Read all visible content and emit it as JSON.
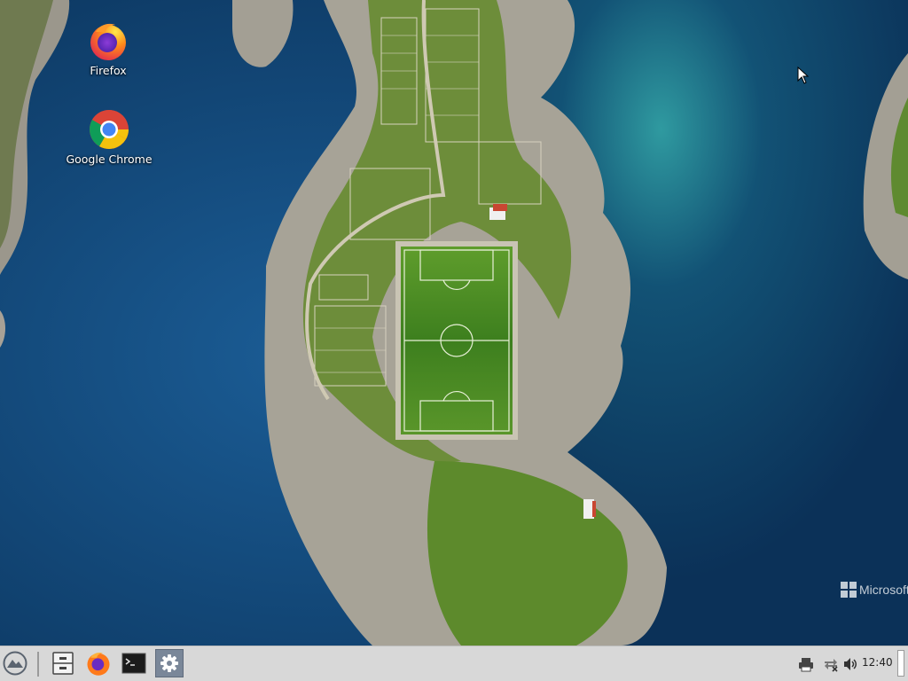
{
  "desktop": {
    "icons": [
      {
        "name": "firefox",
        "label": "Firefox"
      },
      {
        "name": "chrome",
        "label": "Google Chrome"
      }
    ],
    "watermark": "Microsoft"
  },
  "taskbar": {
    "start_icon": "zorin-logo-icon",
    "launchers": [
      {
        "name": "files",
        "icon": "file-cabinet-icon"
      },
      {
        "name": "firefox",
        "icon": "firefox-icon"
      },
      {
        "name": "terminal",
        "icon": "terminal-icon"
      },
      {
        "name": "settings",
        "icon": "gear-icon",
        "active": true
      }
    ],
    "tray": {
      "icons": [
        "printer-icon",
        "network-disconnected-icon",
        "volume-icon"
      ],
      "clock": "12:40"
    }
  },
  "colors": {
    "taskbar_bg": "#d8d8d8",
    "active_launcher": "#7a8799",
    "sea_dark": "#0d3c66",
    "sea_light": "#1f7d8c"
  }
}
